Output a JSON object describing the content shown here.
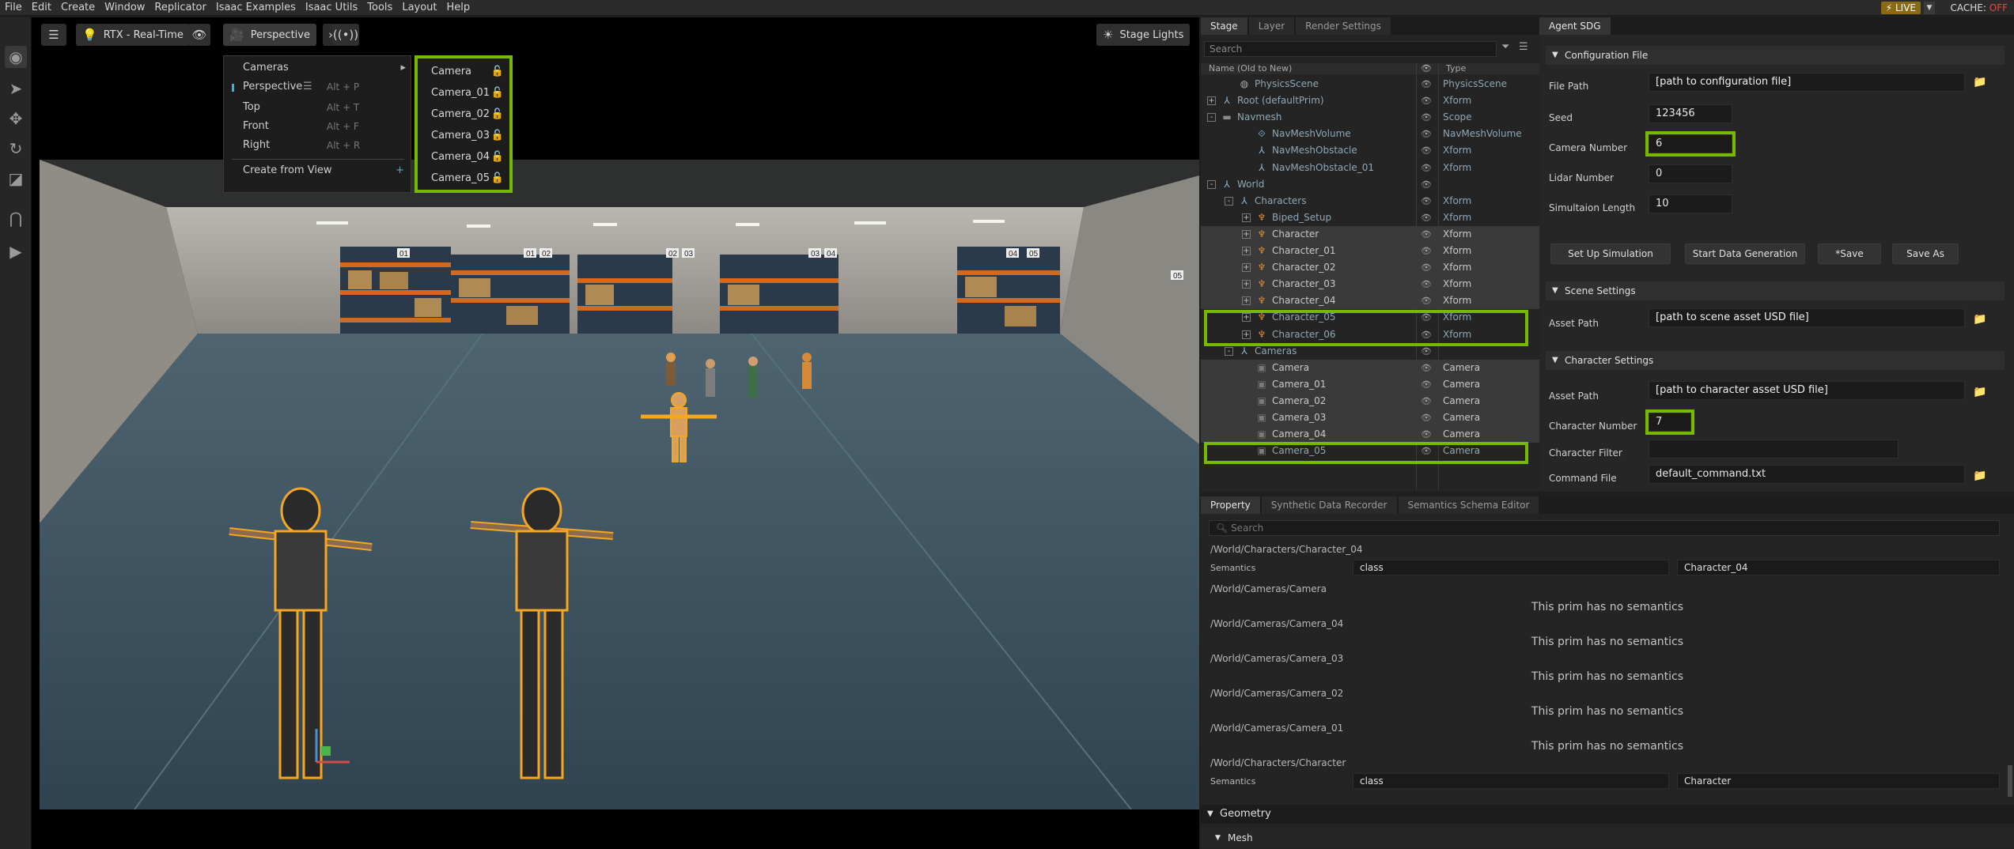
{
  "menubar": {
    "items": [
      "File",
      "Edit",
      "Create",
      "Window",
      "Replicator",
      "Isaac Examples",
      "Isaac Utils",
      "Tools",
      "Layout",
      "Help"
    ],
    "live_label": "LIVE",
    "cache_label": "CACHE:",
    "cache_state": "OFF"
  },
  "viewport": {
    "renderer_label": "RTX - Real-Time",
    "camera_label": "Perspective",
    "stage_lights_label": "Stage Lights",
    "camera_menu": {
      "items": [
        {
          "label": "Cameras",
          "shortcut": "",
          "submenu": true
        },
        {
          "label": "Perspective",
          "shortcut": "Alt + P",
          "selected": true
        },
        {
          "label": "Top",
          "shortcut": "Alt + T"
        },
        {
          "label": "Front",
          "shortcut": "Alt + F"
        },
        {
          "label": "Right",
          "shortcut": "Alt + R"
        },
        {
          "label": "Create from View",
          "shortcut": ""
        }
      ],
      "submenu": [
        "Camera",
        "Camera_01",
        "Camera_02",
        "Camera_03",
        "Camera_04",
        "Camera_05"
      ]
    },
    "rack_labels": [
      "01",
      "01",
      "02",
      "02",
      "03",
      "03",
      "04",
      "04",
      "05",
      "05"
    ]
  },
  "stage": {
    "tabs": [
      "Stage",
      "Layer",
      "Render Settings"
    ],
    "search_placeholder": "Search",
    "header_name": "Name (Old to New)",
    "header_type": "Type",
    "rows": [
      {
        "name": "PhysicsScene",
        "type": "PhysicsScene",
        "depth": 1,
        "exp": "",
        "icon": "physics",
        "dim": true
      },
      {
        "name": "Root (defaultPrim)",
        "type": "Xform",
        "depth": 0,
        "exp": "+",
        "icon": "xform",
        "dim": true
      },
      {
        "name": "Navmesh",
        "type": "Scope",
        "depth": 0,
        "exp": "-",
        "icon": "scope",
        "dim": true
      },
      {
        "name": "NavMeshVolume",
        "type": "NavMeshVolume",
        "depth": 2,
        "exp": "",
        "icon": "navvol",
        "dim": true
      },
      {
        "name": "NavMeshObstacle",
        "type": "Xform",
        "depth": 2,
        "exp": "",
        "icon": "xform",
        "dim": true
      },
      {
        "name": "NavMeshObstacle_01",
        "type": "Xform",
        "depth": 2,
        "exp": "",
        "icon": "xform",
        "dim": true
      },
      {
        "name": "World",
        "type": "",
        "depth": 0,
        "exp": "-",
        "icon": "xform",
        "dim": true
      },
      {
        "name": "Characters",
        "type": "Xform",
        "depth": 1,
        "exp": "-",
        "icon": "xform",
        "dim": true
      },
      {
        "name": "Biped_Setup",
        "type": "Xform",
        "depth": 2,
        "exp": "+",
        "icon": "char",
        "dim": true
      },
      {
        "name": "Character",
        "type": "Xform",
        "depth": 2,
        "exp": "+",
        "icon": "char",
        "sel": true
      },
      {
        "name": "Character_01",
        "type": "Xform",
        "depth": 2,
        "exp": "+",
        "icon": "char",
        "sel": true
      },
      {
        "name": "Character_02",
        "type": "Xform",
        "depth": 2,
        "exp": "+",
        "icon": "char",
        "sel": true
      },
      {
        "name": "Character_03",
        "type": "Xform",
        "depth": 2,
        "exp": "+",
        "icon": "char",
        "sel": true
      },
      {
        "name": "Character_04",
        "type": "Xform",
        "depth": 2,
        "exp": "+",
        "icon": "char",
        "sel": true
      },
      {
        "name": "Character_05",
        "type": "Xform",
        "depth": 2,
        "exp": "+",
        "icon": "char",
        "dim": true
      },
      {
        "name": "Character_06",
        "type": "Xform",
        "depth": 2,
        "exp": "+",
        "icon": "char",
        "dim": true
      },
      {
        "name": "Cameras",
        "type": "",
        "depth": 1,
        "exp": "-",
        "icon": "xform",
        "dim": true
      },
      {
        "name": "Camera",
        "type": "Camera",
        "depth": 2,
        "exp": "",
        "icon": "cam",
        "sel": true
      },
      {
        "name": "Camera_01",
        "type": "Camera",
        "depth": 2,
        "exp": "",
        "icon": "cam",
        "sel": true
      },
      {
        "name": "Camera_02",
        "type": "Camera",
        "depth": 2,
        "exp": "",
        "icon": "cam",
        "sel": true
      },
      {
        "name": "Camera_03",
        "type": "Camera",
        "depth": 2,
        "exp": "",
        "icon": "cam",
        "sel": true
      },
      {
        "name": "Camera_04",
        "type": "Camera",
        "depth": 2,
        "exp": "",
        "icon": "cam",
        "sel": true
      },
      {
        "name": "Camera_05",
        "type": "Camera",
        "depth": 2,
        "exp": "",
        "icon": "cam",
        "dim": true
      }
    ]
  },
  "agent_sdg": {
    "tab": "Agent SDG",
    "config_section": "Configuration File",
    "file_path_label": "File Path",
    "file_path_value": "[path to configuration file]",
    "seed_label": "Seed",
    "seed_value": "123456",
    "camera_number_label": "Camera Number",
    "camera_number_value": "6",
    "lidar_number_label": "Lidar Number",
    "lidar_number_value": "0",
    "sim_length_label": "Simultaion Length",
    "sim_length_value": "10",
    "buttons": [
      "Set Up Simulation",
      "Start Data Generation",
      "*Save",
      "Save As"
    ],
    "scene_section": "Scene Settings",
    "scene_asset_label": "Asset Path",
    "scene_asset_value": "[path to scene asset USD file]",
    "character_section": "Character Settings",
    "char_asset_label": "Asset Path",
    "char_asset_value": "[path to character asset USD file]",
    "char_number_label": "Character Number",
    "char_number_value": "7",
    "char_filter_label": "Character Filter",
    "char_filter_value": "",
    "command_file_label": "Command File",
    "command_file_value": "default_command.txt"
  },
  "property": {
    "tabs": [
      "Property",
      "Synthetic Data Recorder",
      "Semantics Schema Editor"
    ],
    "search_placeholder": "Search",
    "entries": [
      {
        "path": "/World/Characters/Character_04",
        "semantics_label": "Semantics",
        "key": "class",
        "value": "Character_04"
      },
      {
        "path": "/World/Cameras/Camera",
        "note": "This prim has no semantics"
      },
      {
        "path": "/World/Cameras/Camera_04",
        "note": "This prim has no semantics"
      },
      {
        "path": "/World/Cameras/Camera_03",
        "note": "This prim has no semantics"
      },
      {
        "path": "/World/Cameras/Camera_02",
        "note": "This prim has no semantics"
      },
      {
        "path": "/World/Cameras/Camera_01",
        "note": "This prim has no semantics"
      },
      {
        "path": "/World/Characters/Character",
        "semantics_label": "Semantics",
        "key": "class",
        "value": "Character"
      }
    ],
    "geometry_label": "Geometry",
    "mesh_label": "Mesh"
  },
  "colors": {
    "highlight_green": "#76b900",
    "selection_orange": "#f5a623",
    "live_badge": "#8a6a15"
  }
}
